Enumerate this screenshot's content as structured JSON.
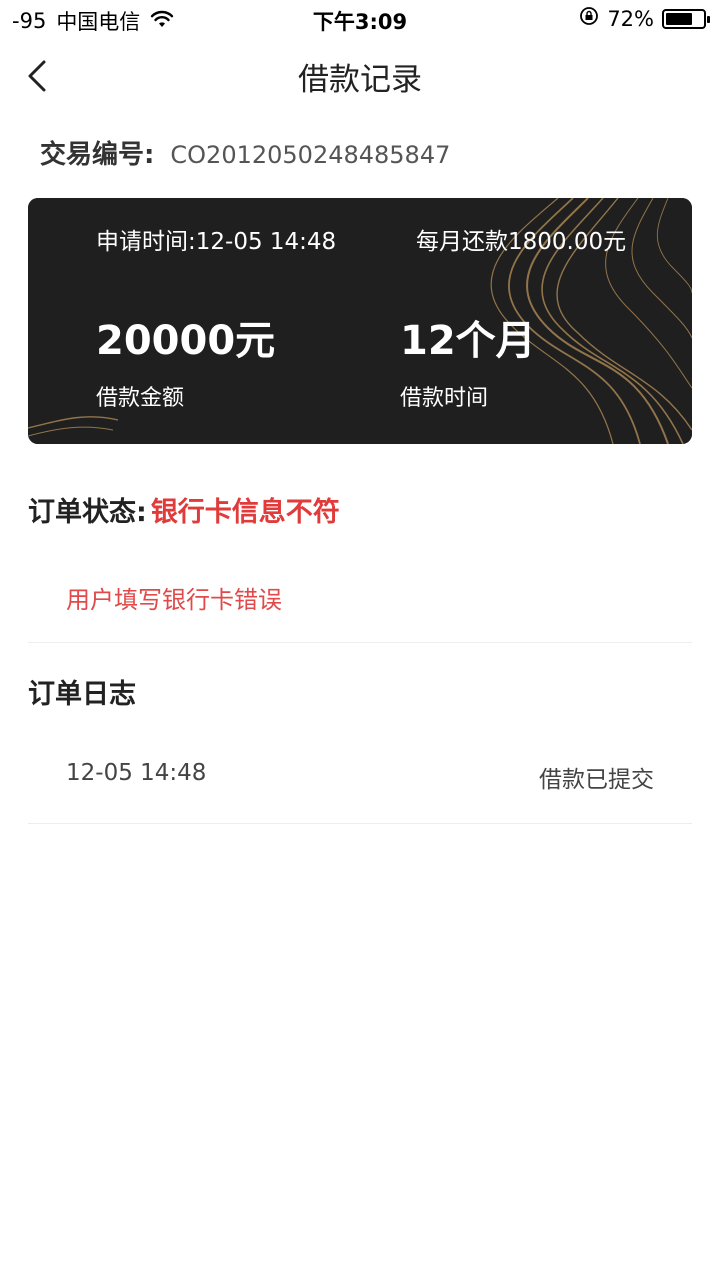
{
  "statusbar": {
    "signal": "-95",
    "carrier": "中国电信",
    "time": "下午3:09",
    "battery_percent": "72%",
    "battery_level": 0.72
  },
  "nav": {
    "title": "借款记录"
  },
  "transaction": {
    "label": "交易编号:",
    "value": "CO2012050248485847"
  },
  "card": {
    "apply_time": "申请时间:12-05 14:48",
    "monthly_repay": "每月还款1800.00元",
    "amount": "20000元",
    "amount_label": "借款金额",
    "period": "12个月",
    "period_label": "借款时间"
  },
  "order_status": {
    "label": "订单状态:",
    "value": "银行卡信息不符",
    "reason": "用户填写银行卡错误"
  },
  "order_log": {
    "title": "订单日志",
    "entries": [
      {
        "time": "12-05 14:48",
        "desc": "借款已提交"
      }
    ]
  },
  "colors": {
    "status_red": "#e03a3a",
    "card_bg": "#1f1f1f",
    "card_gold": "#b8925a"
  }
}
